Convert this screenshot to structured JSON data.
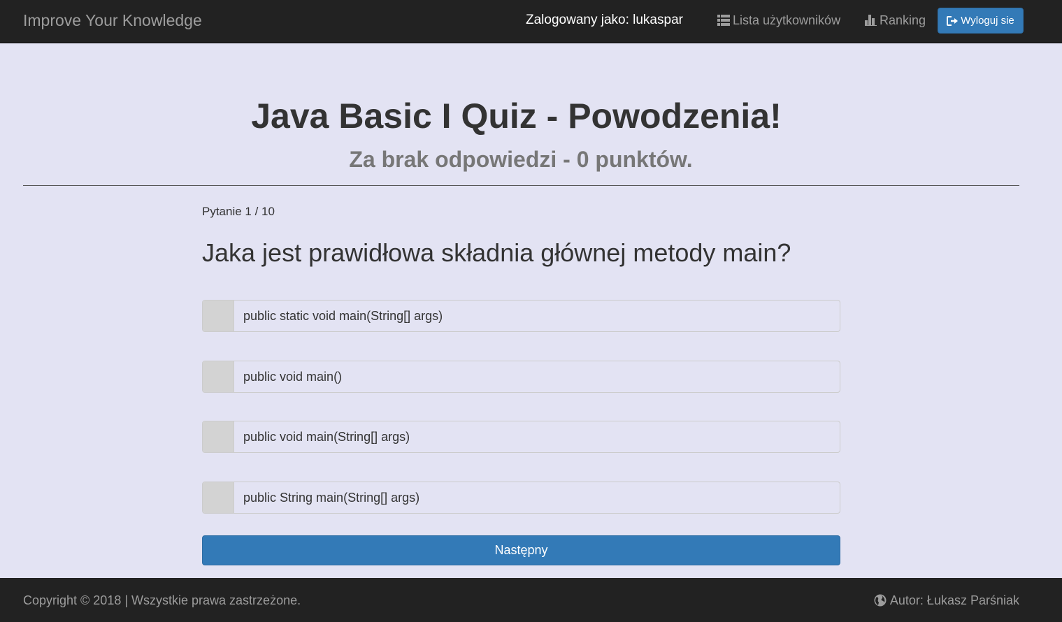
{
  "navbar": {
    "brand": "Improve Your Knowledge",
    "logged_in_as": "Zalogowany jako: lukaspar",
    "users_link": "Lista użytkowników",
    "users_icon": "list-icon",
    "ranking_link": "Ranking",
    "ranking_icon": "bar-chart-icon",
    "logout_label": "Wyloguj sie",
    "logout_icon": "logout-icon"
  },
  "header": {
    "title": "Java Basic I Quiz - Powodzenia!",
    "subtitle": "Za brak odpowiedzi - 0 punktów."
  },
  "quiz": {
    "counter": "Pytanie 1 / 10",
    "question": "Jaka jest prawidłowa składnia głównej metody main?",
    "answers": [
      "public static void main(String[] args)",
      "public void main()",
      "public void main(String[] args)",
      "public String main(String[] args)"
    ],
    "next_label": "Następny"
  },
  "footer": {
    "copyright": "Copyright © 2018 | Wszystkie prawa zastrzeżone.",
    "author": "Autor: Łukasz Parśniak",
    "author_icon": "globe-icon"
  },
  "colors": {
    "navbar_bg": "#222222",
    "page_bg": "#e3e3f3",
    "primary": "#337ab7",
    "addon_bg": "#d3d3d3"
  }
}
